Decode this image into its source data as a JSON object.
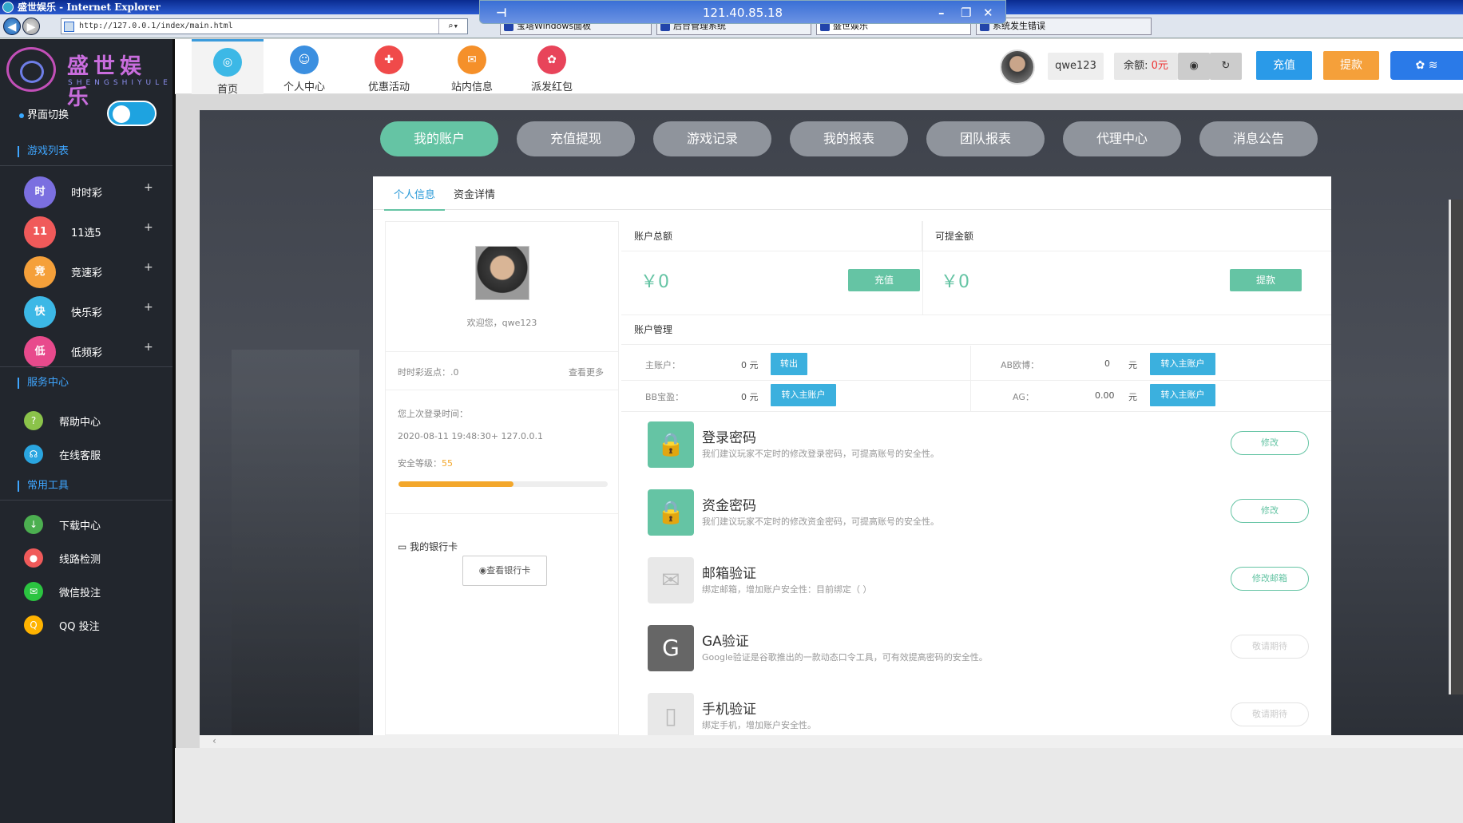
{
  "browser": {
    "title": "盛世娱乐 - Internet Explorer",
    "address": "http://127.0.0.1/index/main.html",
    "tabs": [
      "宝塔Windows面板",
      "后台管理系统",
      "盛世娱乐",
      "系统发生错误"
    ],
    "remote_ip": "121.40.85.18"
  },
  "brand": {
    "name": "盛世娱乐",
    "sub": "SHENGSHIYULE"
  },
  "sidebar": {
    "switch_label": "界面切换",
    "games_title": "游戏列表",
    "games": [
      {
        "label": "时时彩",
        "icon": "时",
        "color": "#7b6fe0"
      },
      {
        "label": "11选5",
        "icon": "11",
        "color": "#f05a5a"
      },
      {
        "label": "竞速彩",
        "icon": "竞",
        "color": "#f5a03a"
      },
      {
        "label": "快乐彩",
        "icon": "快",
        "color": "#3cb8e6"
      },
      {
        "label": "低频彩",
        "icon": "低",
        "color": "#e84a8c"
      }
    ],
    "services_title": "服务中心",
    "services": [
      {
        "label": "帮助中心",
        "icon": "?",
        "color": "#8bc34a"
      },
      {
        "label": "在线客服",
        "icon": "☊",
        "color": "#2aa5e0"
      }
    ],
    "tools_title": "常用工具",
    "tools": [
      {
        "label": "下载中心",
        "icon": "↓",
        "color": "#4caf50"
      },
      {
        "label": "线路检测",
        "icon": "●",
        "color": "#f05a5a"
      },
      {
        "label": "微信投注",
        "icon": "✉",
        "color": "#2bc440"
      },
      {
        "label": "QQ 投注",
        "icon": "Q",
        "color": "#ffb300"
      }
    ]
  },
  "topnav": [
    {
      "label": "首页",
      "icon": "◎",
      "color": "#3cb8e6"
    },
    {
      "label": "个人中心",
      "icon": "☺",
      "color": "#3b8fe0"
    },
    {
      "label": "优惠活动",
      "icon": "✚",
      "color": "#f04a4a"
    },
    {
      "label": "站内信息",
      "icon": "✉",
      "color": "#f5902a"
    },
    {
      "label": "派发红包",
      "icon": "✿",
      "color": "#e8445a"
    }
  ],
  "header": {
    "username": "qwe123",
    "balance_label": "余额:",
    "balance_value": "0元",
    "recharge": "充值",
    "withdraw": "提款"
  },
  "subnav": [
    "我的账户",
    "充值提现",
    "游戏记录",
    "我的报表",
    "团队报表",
    "代理中心",
    "消息公告"
  ],
  "card": {
    "tabs": [
      "个人信息",
      "资金详情"
    ],
    "welcome": "欢迎您，qwe123",
    "rebate_label": "时时彩返点：.0",
    "see_more": "查看更多",
    "last_login_label": "您上次登录时间：",
    "last_login_value": "2020-08-11 19:48:30+ 127.0.0.1",
    "security_label": "安全等级：",
    "security_value": "55",
    "security_level": 55,
    "bank_title": "我的银行卡",
    "bank_btn": "◉查看银行卡",
    "total_label": "账户总额",
    "total_value": "￥0",
    "total_btn": "充值",
    "withdrawable_label": "可提金额",
    "withdrawable_value": "￥0",
    "withdrawable_btn": "提款",
    "acct_title": "账户管理",
    "accounts": {
      "main": {
        "label": "主账户：",
        "value": "0 元",
        "btn": "转出"
      },
      "bb": {
        "label": "BB宝盈：",
        "value": "0 元",
        "btn": "转入主账户"
      },
      "ab": {
        "label": "AB欧博：",
        "value": "0",
        "unit": "元",
        "btn": "转入主账户"
      },
      "ag": {
        "label": "AG：",
        "value": "0.00",
        "unit": "元",
        "btn": "转入主账户"
      }
    },
    "security_items": [
      {
        "title": "登录密码",
        "desc": "我们建议玩家不定时的修改登录密码，可提高账号的安全性。",
        "btn": "修改",
        "icon": "🔒",
        "color": "#65c4a4"
      },
      {
        "title": "资金密码",
        "desc": "我们建议玩家不定时的修改资金密码，可提高账号的安全性。",
        "btn": "修改",
        "icon": "🔒",
        "color": "#65c4a4"
      },
      {
        "title": "邮箱验证",
        "desc": "绑定邮箱，增加账户安全性：目前绑定（ ）",
        "btn": "修改邮箱",
        "icon": "✉",
        "color": "#e8e8e8"
      },
      {
        "title": "GA验证",
        "desc": "Google验证是谷歌推出的一款动态口令工具，可有效提高密码的安全性。",
        "btn": "敬请期待",
        "icon": "G",
        "color": "#666"
      },
      {
        "title": "手机验证",
        "desc": "绑定手机，增加账户安全性。",
        "btn": "敬请期待",
        "icon": "▯",
        "color": "#e8e8e8"
      }
    ]
  }
}
